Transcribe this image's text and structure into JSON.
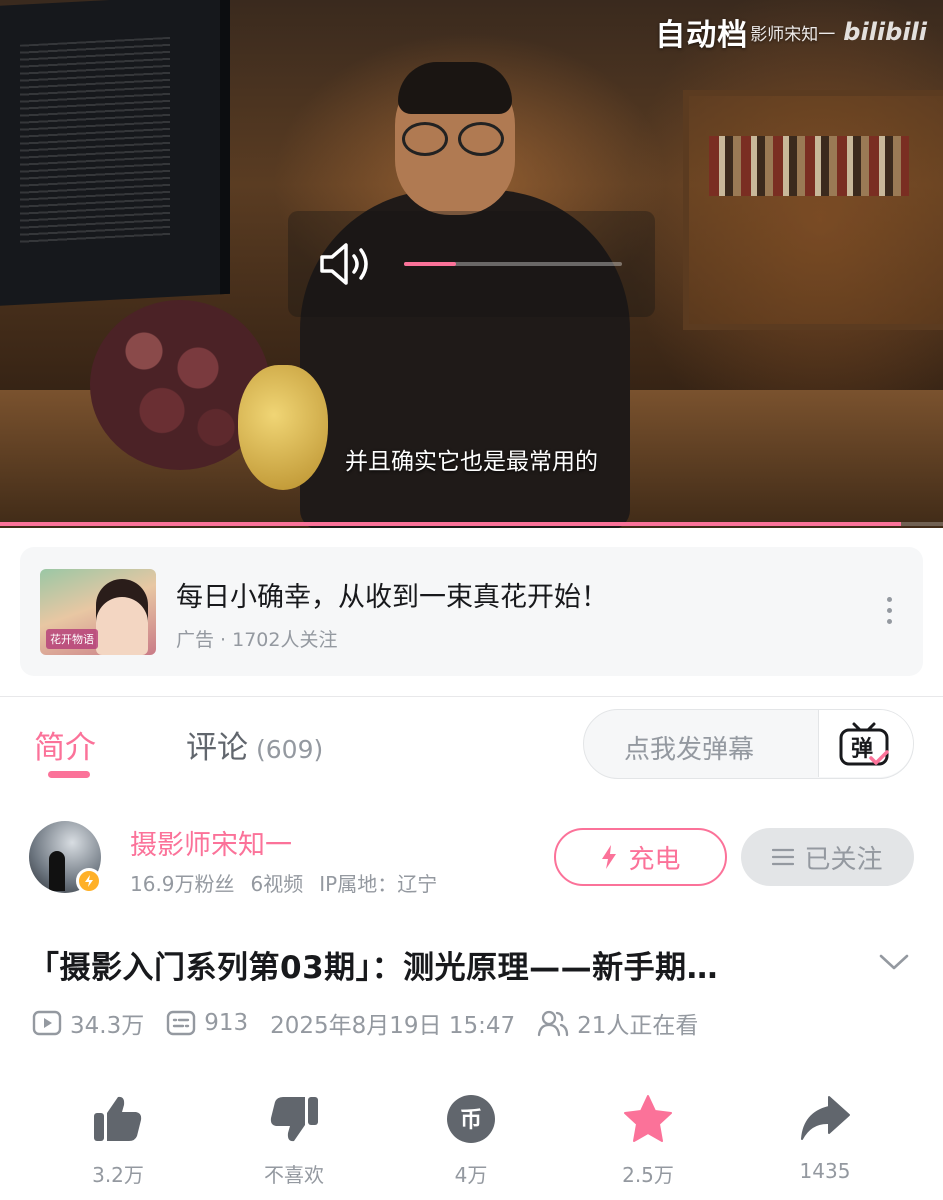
{
  "video": {
    "watermark_title": "自动档",
    "watermark_author": "影师宋知一",
    "watermark_logo": "bilibili",
    "subtitle": "并且确实它也是最常用的",
    "volume_fraction": 0.24,
    "progress_fraction": 0.955
  },
  "ad": {
    "title": "每日小确幸，从收到一束真花开始！",
    "meta": "广告 · 1702人关注",
    "thumb_label": "花开物语"
  },
  "tabs": {
    "intro_label": "简介",
    "comments_label": "评论",
    "comments_count": "(609)",
    "danmaku_placeholder": "点我发弹幕",
    "danmaku_button_char": "弹"
  },
  "uploader": {
    "name": "摄影师宋知一",
    "fans": "16.9万粉丝",
    "videos": "6视频",
    "ip": "IP属地：辽宁",
    "charge_label": "充电",
    "follow_label": "已关注"
  },
  "video_info": {
    "title": "「摄影入门系列第03期」：测光原理——新手期…",
    "views": "34.3万",
    "danmaku_count": "913",
    "publish_time": "2025年8月19日 15:47",
    "watching": "21人正在看"
  },
  "actions": {
    "like": "3.2万",
    "dislike": "不喜欢",
    "coin": "4万",
    "coin_char": "币",
    "favorite": "2.5万",
    "share": "1435"
  },
  "colors": {
    "accent": "#fb7299",
    "text_secondary": "#9499a0",
    "icon_gray": "#61666d"
  }
}
